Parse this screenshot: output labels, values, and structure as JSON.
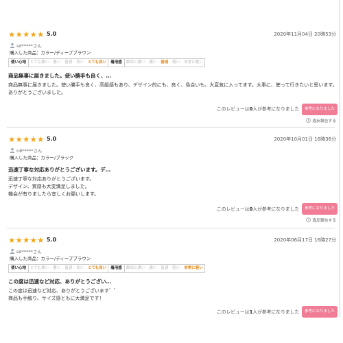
{
  "reviews": [
    {
      "stars": "★★★★★",
      "rating": "5.0",
      "date": "2020年11月04日 20時53分",
      "user": "sd*****さん",
      "product": "購入した商品：カラー/ディープブラウン",
      "usage_category": "使い心地",
      "usage_options": [
        "とても悪い",
        "悪い",
        "普通",
        "良い",
        "とても良い"
      ],
      "usage_selected_index": 4,
      "size_category": "着用感",
      "size_options": [
        "数回に通い",
        "通い",
        "普通",
        "軽い",
        "非常に軽い"
      ],
      "size_selected_index": 2,
      "title": "商品無事に届きました。使い勝手も良く、…",
      "body": [
        "商品無事に届きました。使い勝手も良く、高級感もあり、デザイン的にも、良く、色合いも、大変気に入ってます。大事に、使って行きたいと思います。",
        "ありがとうございました。"
      ],
      "helpful_prefix": "このレビューは",
      "helpful_count": "0",
      "helpful_suffix": "人が参考になりました",
      "helpful_button": "参考になりました",
      "report": "違反報告する"
    },
    {
      "stars": "★★★★★",
      "rating": "5.0",
      "date": "2020年10月01日 16時36分",
      "user": "n8*****さん",
      "product": "購入した商品：カラー/ブラック",
      "title": "迅速丁寧な対応ありがとうございます。デ…",
      "body": [
        "迅速丁寧な対応ありがとうございます。",
        "デザイン、質感も大変満足しました。",
        "機会が有りましたら宜しくお願いします。"
      ],
      "helpful_prefix": "このレビューは",
      "helpful_count": "0",
      "helpful_suffix": "人が参考になりました",
      "helpful_button": "参考になりました",
      "report": "違反報告する"
    },
    {
      "stars": "★★★★★",
      "rating": "5.0",
      "date": "2020年06月17日 16時27分",
      "user": "sd*****さん",
      "product": "購入した商品：カラー/ディープブラウン",
      "usage_category": "使い心地",
      "usage_options": [
        "とても悪い",
        "悪い",
        "普通",
        "良い",
        "とても良い"
      ],
      "usage_selected_index": 4,
      "size_category": "着用感",
      "size_options": [
        "数回に通い",
        "通い",
        "普通",
        "軽い",
        "非常に軽い"
      ],
      "size_selected_index": 4,
      "title": "この度は迅速など対応、ありがとうござい…",
      "body": [
        "この度は迅速など対応、ありがとうございます゛゛",
        "商品も手触り、サイズ感ともに大満足です！"
      ],
      "helpful_prefix": "このレビューは",
      "helpful_count": "1",
      "helpful_suffix": "人が参考になりました",
      "helpful_button": "参考になりました",
      "report": "違反報告する"
    }
  ],
  "colors": {
    "star": "#f3a514",
    "selected_option": "#e38c1d",
    "helpful_button": "#f07c95"
  },
  "icons": {
    "user": "user-icon",
    "report": "warning-circle-icon"
  }
}
